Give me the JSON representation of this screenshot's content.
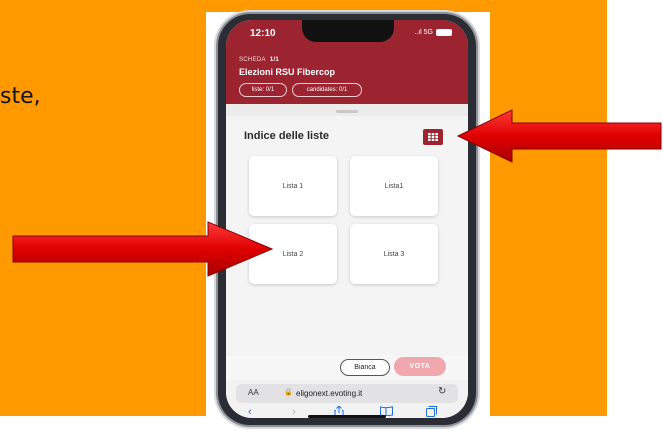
{
  "slide": {
    "text": "ste,"
  },
  "phone": {
    "status": {
      "time": "12:10",
      "signal": "..ıl 5G"
    },
    "header": {
      "scheda_label": "SCHEDA",
      "scheda_value": "1/1",
      "title": "Elezioni RSU Fibercop",
      "pill_liste": "liste: 0/1",
      "pill_candidates": "candidates: 0/1"
    },
    "section": {
      "title": "Indice delle liste"
    },
    "lists": [
      {
        "label": "Lista 1"
      },
      {
        "label": "Lista1"
      },
      {
        "label": "Lista 2"
      },
      {
        "label": "Lista 3"
      }
    ],
    "actions": {
      "bianca": "Bianca",
      "vota": "VOTA"
    },
    "safari": {
      "aa": "AA",
      "url": "eligonext.evoting.it"
    }
  },
  "colors": {
    "slide_bg": "#ff9900",
    "brand": "#9b2430",
    "vota_bg": "#f1a7ae",
    "arrow": "#e00000"
  },
  "icons": [
    "grid-icon",
    "lock-icon",
    "reload-icon",
    "back-icon",
    "forward-icon",
    "share-icon",
    "bookmarks-icon",
    "tabs-icon",
    "arrow-right",
    "arrow-left"
  ]
}
